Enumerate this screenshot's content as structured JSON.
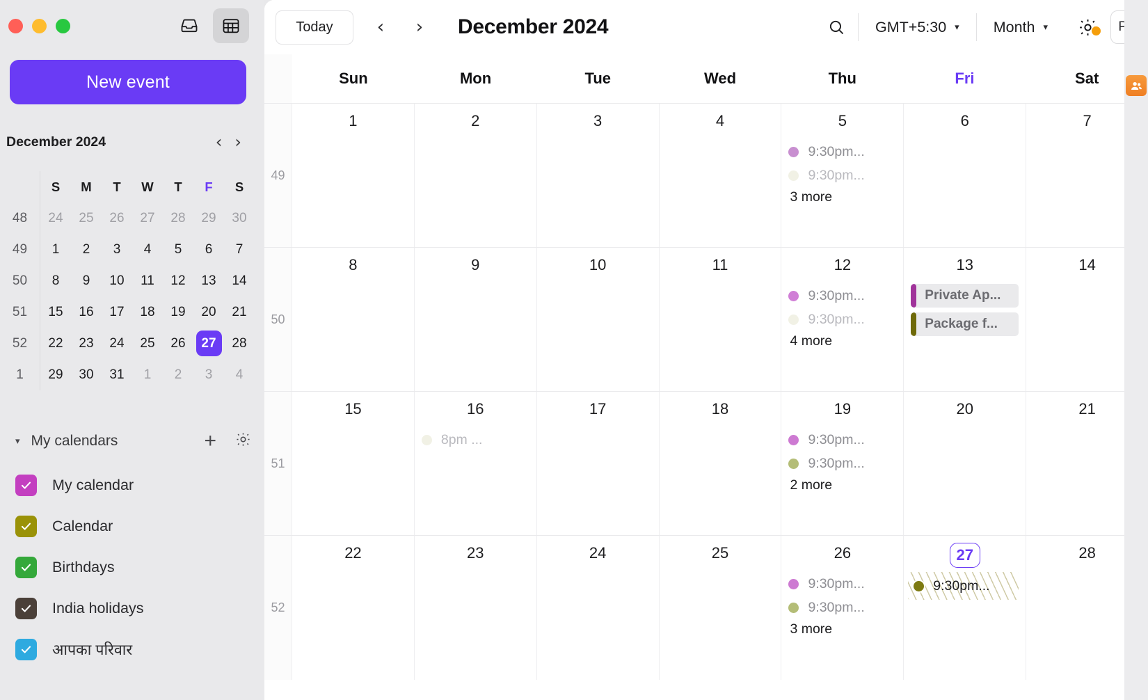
{
  "window": {
    "traffic_lights": [
      "close",
      "minimize",
      "maximize"
    ],
    "colors": {
      "accent": "#6a3bf5",
      "sidebar_bg": "#e9e9eb",
      "main_bg": "#ffffff",
      "badge_orange": "#f59e0b"
    }
  },
  "sidebar": {
    "toggles": [
      {
        "name": "mail-inbox",
        "icon": "inbox-icon",
        "active": false
      },
      {
        "name": "calendar",
        "icon": "calendar-grid-icon",
        "active": true
      }
    ],
    "new_event_label": "New event",
    "mini_calendar": {
      "title": "December 2024",
      "prev_label": "‹",
      "next_label": "›",
      "dow": [
        "S",
        "M",
        "T",
        "W",
        "T",
        "F",
        "S"
      ],
      "today_dow_index": 5,
      "weeks": [
        {
          "wk": "48",
          "days": [
            {
              "n": "24",
              "dim": true
            },
            {
              "n": "25",
              "dim": true
            },
            {
              "n": "26",
              "dim": true
            },
            {
              "n": "27",
              "dim": true
            },
            {
              "n": "28",
              "dim": true
            },
            {
              "n": "29",
              "dim": true
            },
            {
              "n": "30",
              "dim": true
            }
          ]
        },
        {
          "wk": "49",
          "days": [
            {
              "n": "1",
              "dim": false
            },
            {
              "n": "2",
              "dim": false
            },
            {
              "n": "3",
              "dim": false
            },
            {
              "n": "4",
              "dim": false
            },
            {
              "n": "5",
              "dim": false
            },
            {
              "n": "6",
              "dim": false
            },
            {
              "n": "7",
              "dim": false
            }
          ]
        },
        {
          "wk": "50",
          "days": [
            {
              "n": "8",
              "dim": false
            },
            {
              "n": "9",
              "dim": false
            },
            {
              "n": "10",
              "dim": false
            },
            {
              "n": "11",
              "dim": false
            },
            {
              "n": "12",
              "dim": false
            },
            {
              "n": "13",
              "dim": false
            },
            {
              "n": "14",
              "dim": false
            }
          ]
        },
        {
          "wk": "51",
          "days": [
            {
              "n": "15",
              "dim": false
            },
            {
              "n": "16",
              "dim": false
            },
            {
              "n": "17",
              "dim": false
            },
            {
              "n": "18",
              "dim": false
            },
            {
              "n": "19",
              "dim": false
            },
            {
              "n": "20",
              "dim": false
            },
            {
              "n": "21",
              "dim": false
            }
          ]
        },
        {
          "wk": "52",
          "days": [
            {
              "n": "22",
              "dim": false
            },
            {
              "n": "23",
              "dim": false
            },
            {
              "n": "24",
              "dim": false
            },
            {
              "n": "25",
              "dim": false
            },
            {
              "n": "26",
              "dim": false
            },
            {
              "n": "27",
              "dim": false,
              "selected": true
            },
            {
              "n": "28",
              "dim": false
            }
          ]
        },
        {
          "wk": "1",
          "days": [
            {
              "n": "29",
              "dim": false
            },
            {
              "n": "30",
              "dim": false
            },
            {
              "n": "31",
              "dim": false
            },
            {
              "n": "1",
              "dim": true
            },
            {
              "n": "2",
              "dim": true
            },
            {
              "n": "3",
              "dim": true
            },
            {
              "n": "4",
              "dim": true
            }
          ]
        }
      ]
    },
    "calendars_section": {
      "title": "My calendars",
      "collapse_caret": "▾",
      "add_label": "+",
      "settings_icon": "gear-icon",
      "items": [
        {
          "label": "My calendar",
          "color": "#c33fc0",
          "checked": true
        },
        {
          "label": "Calendar",
          "color": "#9a9208",
          "checked": true
        },
        {
          "label": "Birthdays",
          "color": "#34a83a",
          "checked": true
        },
        {
          "label": "India holidays",
          "color": "#4b4039",
          "checked": true
        },
        {
          "label": "आपका परिवार",
          "color": "#2eaae0",
          "checked": true
        }
      ]
    }
  },
  "toolbar": {
    "today_label": "Today",
    "prev_label": "‹",
    "next_label": "›",
    "month_title": "December 2024",
    "search_icon": "search-icon",
    "timezone": "GMT+5:30",
    "view": "Month",
    "caret": "▾",
    "settings_icon": "gear-icon",
    "settings_badge": true,
    "avatar_initials": "PS"
  },
  "right_rail": {
    "items": [
      {
        "name": "contacts-icon",
        "label": "Contacts"
      }
    ]
  },
  "calendar": {
    "day_headers": [
      "Sun",
      "Mon",
      "Tue",
      "Wed",
      "Thu",
      "Fri",
      "Sat"
    ],
    "today_header_index": 5,
    "weeks": [
      {
        "week_number": "49",
        "days": [
          {
            "num": "1",
            "events": []
          },
          {
            "num": "2",
            "events": []
          },
          {
            "num": "3",
            "events": []
          },
          {
            "num": "4",
            "events": []
          },
          {
            "num": "5",
            "events": [
              {
                "type": "dot",
                "time": "9:30pm...",
                "color": "#c88fd0",
                "faint": false
              },
              {
                "type": "dot",
                "time": "9:30pm...",
                "color": "#c0c08a",
                "faint": true
              }
            ],
            "more": "3 more"
          },
          {
            "num": "6",
            "events": []
          },
          {
            "num": "7",
            "events": []
          }
        ]
      },
      {
        "week_number": "50",
        "days": [
          {
            "num": "8",
            "events": []
          },
          {
            "num": "9",
            "events": []
          },
          {
            "num": "10",
            "events": []
          },
          {
            "num": "11",
            "events": []
          },
          {
            "num": "12",
            "events": [
              {
                "type": "dot",
                "time": "9:30pm...",
                "color": "#d07fd6",
                "faint": false
              },
              {
                "type": "dot",
                "time": "9:30pm...",
                "color": "#c0c08a",
                "faint": true
              }
            ],
            "more": "4 more"
          },
          {
            "num": "13",
            "events": [
              {
                "type": "chip",
                "title": "Private Ap...",
                "color": "#a0339a"
              },
              {
                "type": "chip",
                "title": "Package f...",
                "color": "#6f6a09"
              }
            ]
          },
          {
            "num": "14",
            "events": []
          }
        ]
      },
      {
        "week_number": "51",
        "days": [
          {
            "num": "15",
            "events": []
          },
          {
            "num": "16",
            "events": [
              {
                "type": "dot",
                "time": "8pm ...",
                "color": "#c0c08a",
                "faint": true
              }
            ]
          },
          {
            "num": "17",
            "events": []
          },
          {
            "num": "18",
            "events": []
          },
          {
            "num": "19",
            "events": [
              {
                "type": "dot",
                "time": "9:30pm...",
                "color": "#cd7ad2",
                "faint": false
              },
              {
                "type": "dot",
                "time": "9:30pm...",
                "color": "#b4bd77",
                "faint": false
              }
            ],
            "more": "2 more"
          },
          {
            "num": "20",
            "events": []
          },
          {
            "num": "21",
            "events": []
          }
        ]
      },
      {
        "week_number": "52",
        "days": [
          {
            "num": "22",
            "events": []
          },
          {
            "num": "23",
            "events": []
          },
          {
            "num": "24",
            "events": []
          },
          {
            "num": "25",
            "events": []
          },
          {
            "num": "26",
            "events": [
              {
                "type": "dot",
                "time": "9:30pm...",
                "color": "#cd7ad2",
                "faint": false
              },
              {
                "type": "dot",
                "time": "9:30pm...",
                "color": "#b4bd77",
                "faint": false
              }
            ],
            "more": "3 more"
          },
          {
            "num": "27",
            "today": true,
            "events": [
              {
                "type": "tentative",
                "time": "9:30pm...",
                "color": "#7d7a12"
              }
            ]
          },
          {
            "num": "28",
            "events": []
          }
        ]
      }
    ]
  }
}
